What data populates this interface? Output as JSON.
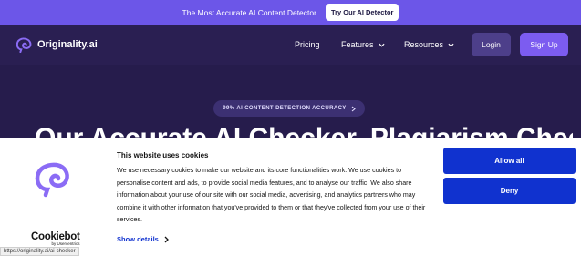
{
  "promo": {
    "text": "The Most Accurate AI Content Detector",
    "button": "Try Our AI Detector"
  },
  "nav": {
    "brand": "Originality.ai",
    "links": [
      "Pricing",
      "Features",
      "Resources"
    ],
    "login": "Login",
    "signup": "Sign Up"
  },
  "hero": {
    "badge": "99% AI CONTENT DETECTION ACCURACY",
    "headline": "Our Accurate AI Checker, Plagiarism Checker"
  },
  "cookie_banner": {
    "title": "This website uses cookies",
    "body": "We use necessary cookies to make our website and its core functionalities work. We use cookies to personalise content and ads, to provide social media features, and to analyse our traffic. We also share information about your use of our site with our social media, advertising, and analytics partners who may combine it with other information that you've provided to them or that they've collected from your use of their services.",
    "show_details": "Show details",
    "allow_all": "Allow all",
    "deny": "Deny",
    "cookiebot_word": "Cookiebot",
    "cookiebot_sub": "by Usercentrics"
  },
  "status_bar": {
    "url": "https://originality.ai/ai-checker"
  },
  "colors": {
    "promo_bg": "#6c56e8",
    "nav_bg": "#2a1f52",
    "signup_bg": "#7c5cf0",
    "cookie_button_bg": "#1032cf"
  },
  "icons": [
    "brain-logo-icon",
    "chevron-down-icon",
    "chevron-right-icon"
  ]
}
